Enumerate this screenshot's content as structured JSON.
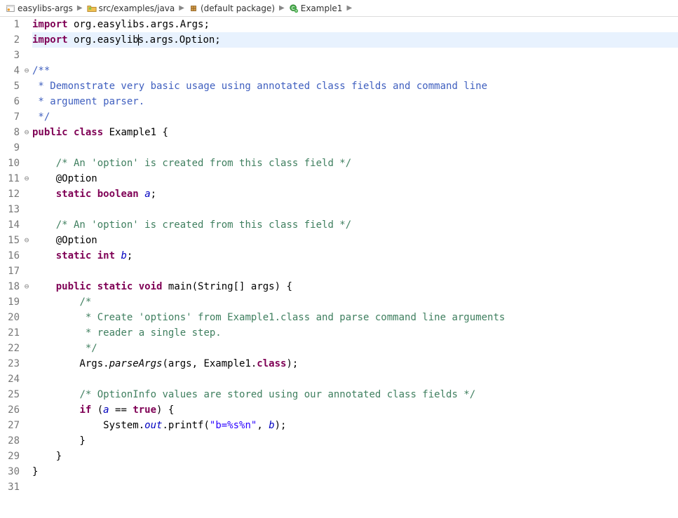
{
  "breadcrumb": {
    "items": [
      {
        "label": "easylibs-args",
        "icon": "project"
      },
      {
        "label": "src/examples/java",
        "icon": "source-folder"
      },
      {
        "label": "(default package)",
        "icon": "package"
      },
      {
        "label": "Example1",
        "icon": "class"
      },
      {
        "label": "",
        "icon": "none"
      }
    ]
  },
  "code": {
    "lines": [
      {
        "n": 1,
        "fold": "",
        "tokens": [
          [
            "kw",
            "import"
          ],
          [
            "plain",
            " org.easylibs.args.Args;"
          ]
        ]
      },
      {
        "n": 2,
        "fold": "",
        "tokens": [
          [
            "kw",
            "import"
          ],
          [
            "plain",
            " org.easylib"
          ],
          [
            "caret",
            ""
          ],
          [
            "plain",
            "s.args.Option;"
          ]
        ],
        "highlight": true
      },
      {
        "n": 3,
        "fold": "",
        "tokens": []
      },
      {
        "n": 4,
        "fold": "⊖",
        "tokens": [
          [
            "javadoc",
            "/**"
          ]
        ]
      },
      {
        "n": 5,
        "fold": "",
        "tokens": [
          [
            "javadoc",
            " * Demonstrate very basic usage using annotated class fields and command line"
          ]
        ]
      },
      {
        "n": 6,
        "fold": "",
        "tokens": [
          [
            "javadoc",
            " * argument parser."
          ]
        ]
      },
      {
        "n": 7,
        "fold": "",
        "tokens": [
          [
            "javadoc",
            " */"
          ]
        ]
      },
      {
        "n": 8,
        "fold": "⊖",
        "tokens": [
          [
            "kw",
            "public"
          ],
          [
            "plain",
            " "
          ],
          [
            "kw",
            "class"
          ],
          [
            "plain",
            " Example1 {"
          ]
        ]
      },
      {
        "n": 9,
        "fold": "",
        "tokens": []
      },
      {
        "n": 10,
        "fold": "",
        "tokens": [
          [
            "plain",
            "    "
          ],
          [
            "comment",
            "/* An 'option' is created from this class field */"
          ]
        ]
      },
      {
        "n": 11,
        "fold": "⊖",
        "tokens": [
          [
            "plain",
            "    @Option"
          ]
        ]
      },
      {
        "n": 12,
        "fold": "",
        "tokens": [
          [
            "plain",
            "    "
          ],
          [
            "kw",
            "static"
          ],
          [
            "plain",
            " "
          ],
          [
            "kw",
            "boolean"
          ],
          [
            "plain",
            " "
          ],
          [
            "field-static",
            "a"
          ],
          [
            "plain",
            ";"
          ]
        ]
      },
      {
        "n": 13,
        "fold": "",
        "tokens": []
      },
      {
        "n": 14,
        "fold": "",
        "tokens": [
          [
            "plain",
            "    "
          ],
          [
            "comment",
            "/* An 'option' is created from this class field */"
          ]
        ]
      },
      {
        "n": 15,
        "fold": "⊖",
        "tokens": [
          [
            "plain",
            "    @Option"
          ]
        ]
      },
      {
        "n": 16,
        "fold": "",
        "tokens": [
          [
            "plain",
            "    "
          ],
          [
            "kw",
            "static"
          ],
          [
            "plain",
            " "
          ],
          [
            "kw",
            "int"
          ],
          [
            "plain",
            " "
          ],
          [
            "field-static",
            "b"
          ],
          [
            "plain",
            ";"
          ]
        ]
      },
      {
        "n": 17,
        "fold": "",
        "tokens": []
      },
      {
        "n": 18,
        "fold": "⊖",
        "tokens": [
          [
            "plain",
            "    "
          ],
          [
            "kw",
            "public"
          ],
          [
            "plain",
            " "
          ],
          [
            "kw",
            "static"
          ],
          [
            "plain",
            " "
          ],
          [
            "kw",
            "void"
          ],
          [
            "plain",
            " main(String[] args) {"
          ]
        ]
      },
      {
        "n": 19,
        "fold": "",
        "tokens": [
          [
            "plain",
            "        "
          ],
          [
            "comment",
            "/*"
          ]
        ]
      },
      {
        "n": 20,
        "fold": "",
        "tokens": [
          [
            "plain",
            "        "
          ],
          [
            "comment",
            " * Create 'options' from Example1.class and parse command line arguments"
          ]
        ]
      },
      {
        "n": 21,
        "fold": "",
        "tokens": [
          [
            "plain",
            "        "
          ],
          [
            "comment",
            " * reader a single step."
          ]
        ]
      },
      {
        "n": 22,
        "fold": "",
        "tokens": [
          [
            "plain",
            "        "
          ],
          [
            "comment",
            " */"
          ]
        ]
      },
      {
        "n": 23,
        "fold": "",
        "tokens": [
          [
            "plain",
            "        Args."
          ],
          [
            "method-static",
            "parseArgs"
          ],
          [
            "plain",
            "(args, Example1."
          ],
          [
            "kw",
            "class"
          ],
          [
            "plain",
            ");"
          ]
        ]
      },
      {
        "n": 24,
        "fold": "",
        "tokens": []
      },
      {
        "n": 25,
        "fold": "",
        "tokens": [
          [
            "plain",
            "        "
          ],
          [
            "comment",
            "/* OptionInfo values are stored using our annotated class fields */"
          ]
        ]
      },
      {
        "n": 26,
        "fold": "",
        "tokens": [
          [
            "plain",
            "        "
          ],
          [
            "kw",
            "if"
          ],
          [
            "plain",
            " ("
          ],
          [
            "field-static",
            "a"
          ],
          [
            "plain",
            " == "
          ],
          [
            "kw",
            "true"
          ],
          [
            "plain",
            ") {"
          ]
        ]
      },
      {
        "n": 27,
        "fold": "",
        "tokens": [
          [
            "plain",
            "            System."
          ],
          [
            "field-static",
            "out"
          ],
          [
            "plain",
            ".printf("
          ],
          [
            "string",
            "\"b=%s%n\""
          ],
          [
            "plain",
            ", "
          ],
          [
            "field-static",
            "b"
          ],
          [
            "plain",
            ");"
          ]
        ]
      },
      {
        "n": 28,
        "fold": "",
        "tokens": [
          [
            "plain",
            "        }"
          ]
        ]
      },
      {
        "n": 29,
        "fold": "",
        "tokens": [
          [
            "plain",
            "    }"
          ]
        ]
      },
      {
        "n": 30,
        "fold": "",
        "tokens": [
          [
            "plain",
            "}"
          ]
        ]
      },
      {
        "n": 31,
        "fold": "",
        "tokens": []
      }
    ]
  }
}
